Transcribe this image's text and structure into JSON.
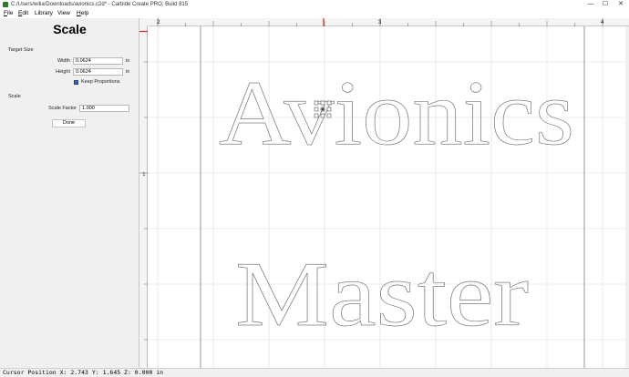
{
  "window": {
    "title": "C:/Users/wilia/Downloads/avionics.c2d* - Carbide Create PRO, Build 815",
    "minimize": "—",
    "maximize": "☐",
    "close": "✕"
  },
  "menu": {
    "items": [
      {
        "label_u": "F",
        "label_rest": "ile"
      },
      {
        "label_u": "E",
        "label_rest": "dit"
      },
      {
        "label_u": "",
        "label_rest": "Library"
      },
      {
        "label_u": "",
        "label_rest": "View"
      },
      {
        "label_u": "H",
        "label_rest": "elp"
      }
    ]
  },
  "panel": {
    "title": "Scale",
    "target_size_label": "Target Size",
    "width_label": "Width",
    "width_value": "0.0624",
    "width_unit": "in",
    "height_label": "Height",
    "height_value": "0.0624",
    "height_unit": "in",
    "keep_proportions_label": "Keep Proportions",
    "keep_proportions_checked": true,
    "scale_section_label": "Scale",
    "scale_factor_label": "Scale Factor",
    "scale_factor_value": "1.000",
    "done_label": "Done"
  },
  "ruler": {
    "top_labels": [
      "2",
      "3",
      "4"
    ],
    "left_labels": [
      "1"
    ],
    "marker_color": "#e02020"
  },
  "canvas": {
    "text_line1": "Avionics",
    "text_line2": "Master",
    "outline_color": "#808080",
    "grid_color": "#dcdcdc",
    "background": "#ffffff"
  },
  "status": {
    "cursor_position": "Cursor Position X: 2.743 Y: 1.645 Z: 0.000 in"
  }
}
